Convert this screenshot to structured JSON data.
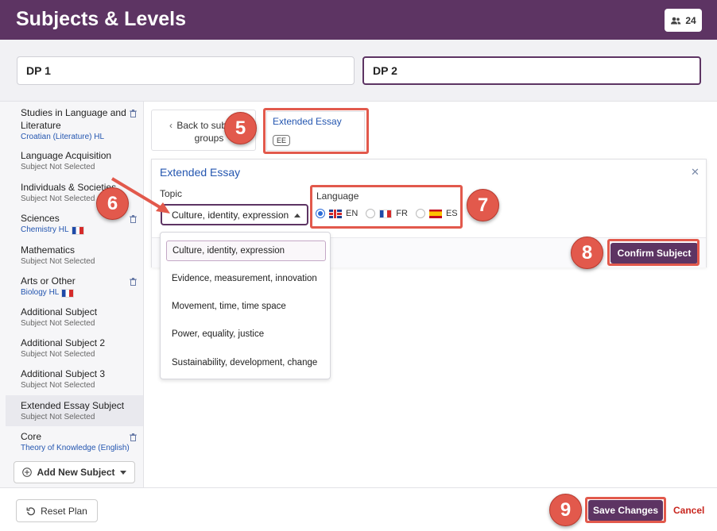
{
  "header": {
    "title": "Subjects & Levels",
    "users_icon": "users-icon",
    "user_count": "24"
  },
  "dp_tabs": [
    {
      "label": "DP 1"
    },
    {
      "label": "DP 2"
    }
  ],
  "sidebar": {
    "items": [
      {
        "name": "Studies in Language and Literature",
        "sub": "Croatian (Literature) HL"
      },
      {
        "name": "Language Acquisition",
        "sub": "Subject Not Selected"
      },
      {
        "name": "Individuals & Societies",
        "sub": "Subject Not Selected"
      },
      {
        "name": "Sciences",
        "sub": "Chemistry HL"
      },
      {
        "name": "Mathematics",
        "sub": "Subject Not Selected"
      },
      {
        "name": "Arts or Other",
        "sub": "Biology HL"
      },
      {
        "name": "Additional Subject",
        "sub": "Subject Not Selected"
      },
      {
        "name": "Additional Subject 2",
        "sub": "Subject Not Selected"
      },
      {
        "name": "Additional Subject 3",
        "sub": "Subject Not Selected"
      },
      {
        "name": "Extended Essay Subject",
        "sub": "Subject Not Selected"
      },
      {
        "name": "Core",
        "sub": "Theory of Knowledge (English)"
      }
    ],
    "add_label": "Add New Subject"
  },
  "main": {
    "back_label": "Back to subject groups",
    "card": {
      "title": "Extended Essay",
      "code": "EE"
    }
  },
  "modal": {
    "title": "Extended Essay",
    "topic_label": "Topic",
    "topic_value": "Culture, identity, expression",
    "language_label": "Language",
    "languages": [
      {
        "code": "EN",
        "selected": true
      },
      {
        "code": "FR",
        "selected": false
      },
      {
        "code": "ES",
        "selected": false
      }
    ],
    "confirm_label": "Confirm Subject"
  },
  "dropdown": {
    "options": [
      "Culture, identity, expression",
      "Evidence, measurement, innovation",
      "Movement, time, time space",
      "Power, equality, justice",
      "Sustainability, development, change"
    ]
  },
  "footer": {
    "reset_label": "Reset Plan",
    "save_label": "Save Changes",
    "cancel_label": "Cancel"
  },
  "annotations": {
    "n5": "5",
    "n6": "6",
    "n7": "7",
    "n8": "8",
    "n9": "9"
  },
  "colors": {
    "brand": "#5d3463",
    "link": "#2456b0",
    "annotation": "#e2594c",
    "cancel": "#c8261e"
  }
}
